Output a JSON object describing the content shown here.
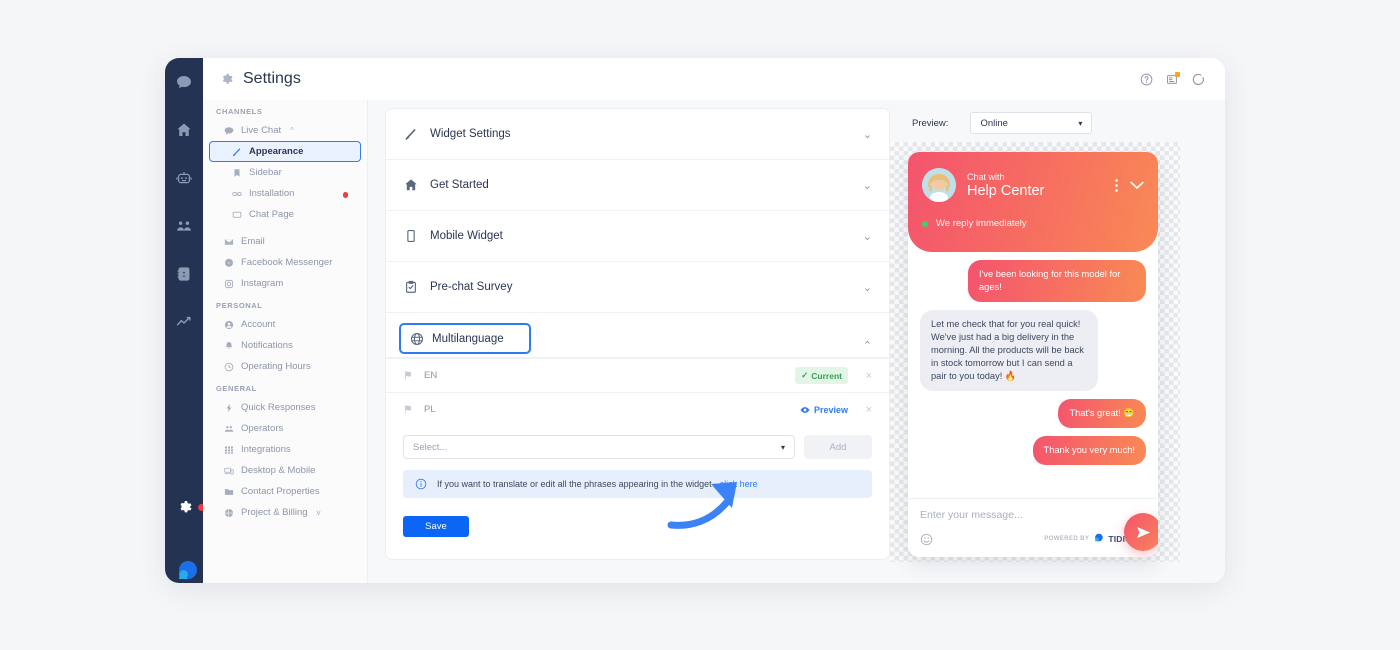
{
  "window": {
    "title": "Settings",
    "gear_icon": "gear-icon"
  },
  "topbar_icons": [
    {
      "name": "help-icon",
      "label": "?"
    },
    {
      "name": "news-icon",
      "label": ""
    },
    {
      "name": "loading-icon",
      "label": ""
    }
  ],
  "rail": {
    "items": [
      {
        "name": "chat-icon",
        "label": "Chat"
      },
      {
        "name": "home-icon",
        "label": "Home"
      },
      {
        "name": "bot-icon",
        "label": "Chatbots"
      },
      {
        "name": "visitors-icon",
        "label": "Visitors"
      },
      {
        "name": "contacts-icon",
        "label": "Contacts"
      },
      {
        "name": "analytics-icon",
        "label": "Analytics"
      }
    ],
    "settings_label": "Settings"
  },
  "sidebar": {
    "groups": [
      {
        "header": "CHANNELS",
        "items": [
          {
            "label": "Live Chat",
            "icon": "chat-bubble-icon",
            "caret": "^",
            "selected": false,
            "sub": false,
            "dot": false
          },
          {
            "label": "Appearance",
            "icon": "brush-icon",
            "caret": "",
            "selected": true,
            "sub": true,
            "dot": false
          },
          {
            "label": "Sidebar",
            "icon": "bookmark-icon",
            "caret": "",
            "selected": false,
            "sub": true,
            "dot": false
          },
          {
            "label": "Installation",
            "icon": "link-icon",
            "caret": "",
            "selected": false,
            "sub": true,
            "dot": true
          },
          {
            "label": "Chat Page",
            "icon": "window-icon",
            "caret": "",
            "selected": false,
            "sub": true,
            "dot": false
          },
          {
            "label": "Email",
            "icon": "mail-icon",
            "caret": "",
            "selected": false,
            "sub": false,
            "dot": false
          },
          {
            "label": "Facebook Messenger",
            "icon": "messenger-icon",
            "caret": "",
            "selected": false,
            "sub": false,
            "dot": false
          },
          {
            "label": "Instagram",
            "icon": "instagram-icon",
            "caret": "",
            "selected": false,
            "sub": false,
            "dot": false
          }
        ]
      },
      {
        "header": "PERSONAL",
        "items": [
          {
            "label": "Account",
            "icon": "user-icon",
            "caret": "",
            "selected": false,
            "sub": false,
            "dot": false
          },
          {
            "label": "Notifications",
            "icon": "bell-icon",
            "caret": "",
            "selected": false,
            "sub": false,
            "dot": false
          },
          {
            "label": "Operating Hours",
            "icon": "clock-icon",
            "caret": "",
            "selected": false,
            "sub": false,
            "dot": false
          }
        ]
      },
      {
        "header": "GENERAL",
        "items": [
          {
            "label": "Quick Responses",
            "icon": "bolt-icon",
            "caret": "",
            "selected": false,
            "sub": false,
            "dot": false
          },
          {
            "label": "Operators",
            "icon": "operators-icon",
            "caret": "",
            "selected": false,
            "sub": false,
            "dot": false
          },
          {
            "label": "Integrations",
            "icon": "grid-icon",
            "caret": "",
            "selected": false,
            "sub": false,
            "dot": false
          },
          {
            "label": "Desktop & Mobile",
            "icon": "devices-icon",
            "caret": "",
            "selected": false,
            "sub": false,
            "dot": false
          },
          {
            "label": "Contact Properties",
            "icon": "folder-icon",
            "caret": "",
            "selected": false,
            "sub": false,
            "dot": false
          },
          {
            "label": "Project & Billing",
            "icon": "globe-small-icon",
            "caret": "v",
            "selected": false,
            "sub": false,
            "dot": false
          }
        ]
      }
    ]
  },
  "settings_sections": [
    {
      "label": "Widget Settings",
      "icon": "brush-icon",
      "chevron": "⌄",
      "expanded": false
    },
    {
      "label": "Get Started",
      "icon": "home-icon",
      "chevron": "⌄",
      "expanded": false
    },
    {
      "label": "Mobile Widget",
      "icon": "mobile-icon",
      "chevron": "⌄",
      "expanded": false
    },
    {
      "label": "Pre-chat Survey",
      "icon": "clipboard-icon",
      "chevron": "⌄",
      "expanded": false
    },
    {
      "label": "Multilanguage",
      "icon": "globe-icon",
      "chevron": "⌃",
      "expanded": true
    }
  ],
  "multilanguage": {
    "languages": [
      {
        "code": "EN",
        "status": "Current",
        "status_type": "current",
        "check": "✓",
        "close": "×"
      },
      {
        "code": "PL",
        "status": "Preview",
        "status_type": "preview",
        "check": "",
        "close": "×"
      }
    ],
    "select_placeholder": "Select...",
    "select_arrow": "▾",
    "add_label": "Add",
    "info_text": "If you want to translate or edit all the phrases appearing in the widget - ",
    "info_link": "click here",
    "save_label": "Save"
  },
  "preview": {
    "label": "Preview:",
    "status_value": "Online",
    "status_arrow": "▾"
  },
  "chat_widget": {
    "chat_with": "Chat with",
    "title": "Help Center",
    "reply_status": "We reply immediately",
    "messages": [
      {
        "from": "visitor",
        "text": "I've been looking for this model for ages!",
        "short": false
      },
      {
        "from": "operator",
        "text": "Let me check that for you real quick! We've just had a big delivery in the morning. All the products will be back in stock tomorrow but I can send a pair to you today! 🔥",
        "short": false
      },
      {
        "from": "visitor",
        "text": "That's great! 😁",
        "short": true
      },
      {
        "from": "visitor",
        "text": "Thank you very much!",
        "short": true
      }
    ],
    "input_placeholder": "Enter your message...",
    "powered_by": "POWERED BY",
    "brand": "TIDIO"
  },
  "colors": {
    "accent_blue": "#2f7bf6",
    "save_blue": "#0b66f5",
    "rail_dark": "#243352",
    "widget_gradient_start": "#f4546e",
    "widget_gradient_end": "#f98a55",
    "current_green": "#2ea44f",
    "badge_red": "#ef3c3c",
    "page_bg": "#f5f6f8"
  }
}
